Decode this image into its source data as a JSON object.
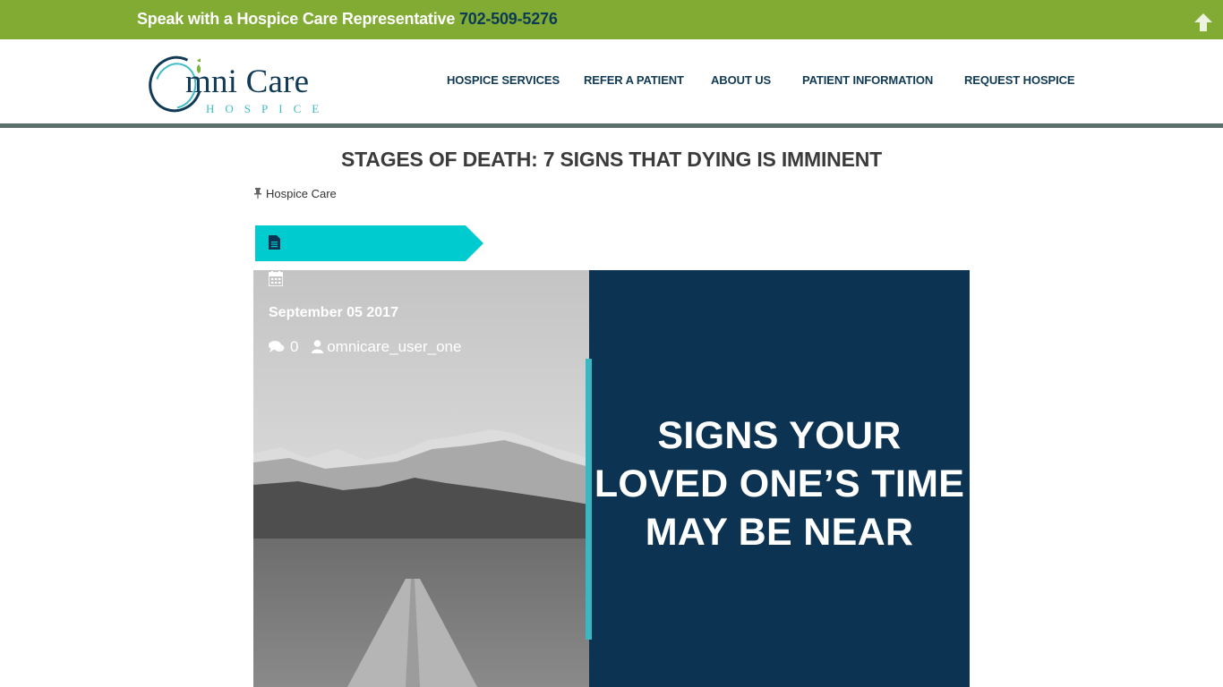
{
  "topbar": {
    "text": "Speak with a Hospice Care Representative ",
    "phone": "702-509-5276",
    "scroll_icon": "arrow-up-icon"
  },
  "logo": {
    "word": "mni Care",
    "sub": "HOSPICE"
  },
  "nav": {
    "items": [
      {
        "label": "HOSPICE SERVICES"
      },
      {
        "label": "REFER A PATIENT"
      },
      {
        "label": "ABOUT US"
      },
      {
        "label": "PATIENT INFORMATION"
      },
      {
        "label": "REQUEST HOSPICE"
      }
    ]
  },
  "post": {
    "title": "STAGES OF DEATH: 7 SIGNS THAT DYING IS IMMINENT",
    "category": "Hospice Care",
    "date": "September 05 2017",
    "comments": "0",
    "author": "omnicare_user_one",
    "featured_text": "SIGNS YOUR LOVED ONE’S TIME MAY BE NEAR"
  },
  "colors": {
    "topbar": "#82ab34",
    "brand_navy": "#103a55",
    "panel": "#0c3352",
    "teal": "#00cccf",
    "accent_bar": "#3bb7c2"
  }
}
